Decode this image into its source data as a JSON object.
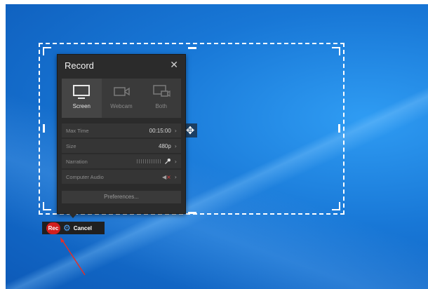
{
  "panel": {
    "title": "Record",
    "close_icon": "✕",
    "modes": [
      {
        "label": "Screen",
        "icon": "monitor-icon",
        "active": true
      },
      {
        "label": "Webcam",
        "icon": "webcam-icon",
        "active": false
      },
      {
        "label": "Both",
        "icon": "screen-and-webcam-icon",
        "active": false
      }
    ],
    "settings": {
      "max_time": {
        "label": "Max Time",
        "value": "00:15:00"
      },
      "size": {
        "label": "Size",
        "value": "480p"
      },
      "narration": {
        "label": "Narration"
      },
      "computer_audio": {
        "label": "Computer Audio"
      }
    },
    "preferences_label": "Preferences..."
  },
  "toolbar": {
    "rec_label": "Rec",
    "cancel_label": "Cancel"
  },
  "move_handle_icon": "✥",
  "colors": {
    "rec": "#d11f1f",
    "panel_bg": "#2b2b2b",
    "gear": "#4da6ff",
    "annotation_arrow": "#e0302a"
  }
}
